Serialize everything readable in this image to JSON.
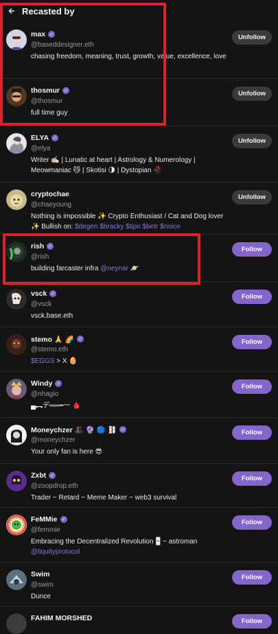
{
  "header": {
    "back_icon": "arrow-left-icon",
    "title": "Recasted by"
  },
  "colors": {
    "accent": "#8465cb",
    "highlight": "#e0202a"
  },
  "users": [
    {
      "name": "max",
      "handle": "@baseddesigner.eth",
      "bio": "chasing freedom, meaning, trust, growth, value, excellence, love",
      "button": "Unfollow"
    },
    {
      "name": "thosmur",
      "handle": "@thosmur",
      "bio": "full time guy",
      "button": "Unfollow"
    },
    {
      "name": "ELYA",
      "handle": "@elya",
      "bio": "Writer ✍🏻 | Lunatic at heart | Astrology & Numerology | Meowmaniac 😼 | Skotisi 🌗 | Dystopian 🥀",
      "button": "Unfollow"
    },
    {
      "name": "cryptochae",
      "handle": "@chaeyoung",
      "bio_text": "Nothing is impossible ✨ Crypto Enthusiast / Cat and Dog lover ✨ Bullish on: ",
      "bio_link": "$degen $bracky $tipn $betr $noice",
      "button": "Unfollow"
    },
    {
      "name": "rish",
      "handle": "@rish",
      "bio_text": "building farcaster infra ",
      "bio_link": "@neynar",
      "bio_after": " 🪐",
      "button": "Follow"
    },
    {
      "name": "vsck",
      "handle": "@vsck",
      "bio": "vsck.base.eth",
      "button": "Follow"
    },
    {
      "name": "stemo 🙏 🌈",
      "handle": "@stemo.eth",
      "bio_link": "$EGGS",
      "bio_after": " > X 🥚",
      "button": "Follow"
    },
    {
      "name": "Windy",
      "handle": "@nhagio",
      "bio": "▄︻デ══━一 🩸",
      "button": "Follow"
    },
    {
      "name": "Moneychzer 🎩 🔮 🔵 ⛓",
      "handle": "@moneychzer",
      "bio": "Your only fan is here 😎",
      "button": "Follow"
    },
    {
      "name": "Zxbt",
      "handle": "@zoopdrop.eth",
      "bio": "Trader ~ Retard ~ Meme Maker ~ web3 survival",
      "button": "Follow"
    },
    {
      "name": "FeMMie",
      "handle": "@femmie",
      "bio": "Embracing the Decentralized Revolution 🁢 ~ astroman",
      "bio_link2": "@liquityprotocol",
      "button": "Follow"
    },
    {
      "name": "Swim",
      "handle": "@swim",
      "bio": "Dunce",
      "button": "Follow"
    },
    {
      "name": "FAHIM MORSHED",
      "handle": "",
      "bio": "",
      "button": "Follow"
    }
  ]
}
